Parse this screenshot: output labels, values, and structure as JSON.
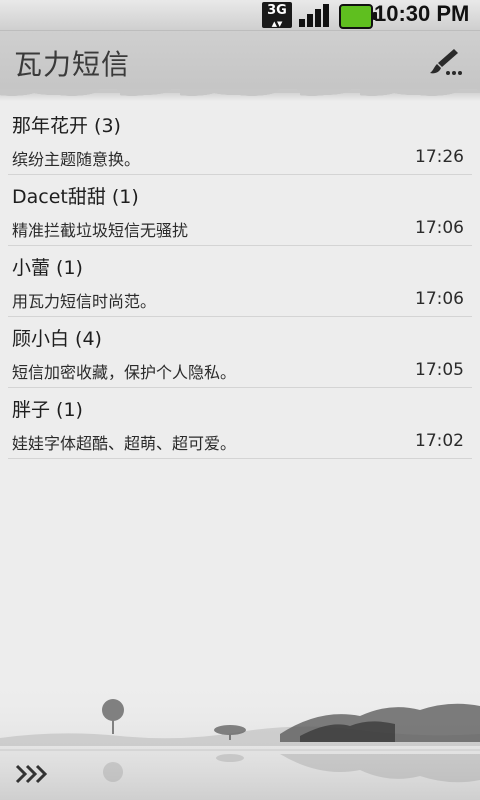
{
  "status_bar": {
    "network": "3G",
    "time": "10:30 PM",
    "icons": [
      "3g-icon",
      "signal-icon",
      "battery-icon"
    ]
  },
  "header": {
    "title": "瓦力短信",
    "compose_icon": "brush-pen-icon"
  },
  "conversations": [
    {
      "name": "那年花开 (3)",
      "preview": "缤纷主题随意换。",
      "time": "17:26"
    },
    {
      "name": "Dacet甜甜 (1)",
      "preview": "精准拦截垃圾短信无骚扰",
      "time": "17:06"
    },
    {
      "name": "小蕾 (1)",
      "preview": "用瓦力短信时尚范。",
      "time": "17:06"
    },
    {
      "name": "顾小白 (4)",
      "preview": "短信加密收藏，保护个人隐私。",
      "time": "17:05"
    },
    {
      "name": "胖子 (1)",
      "preview": "娃娃字体超酷、超萌、超可爱。",
      "time": "17:02"
    }
  ],
  "footer": {
    "menu_icon": "double-chevron-right-icon"
  }
}
